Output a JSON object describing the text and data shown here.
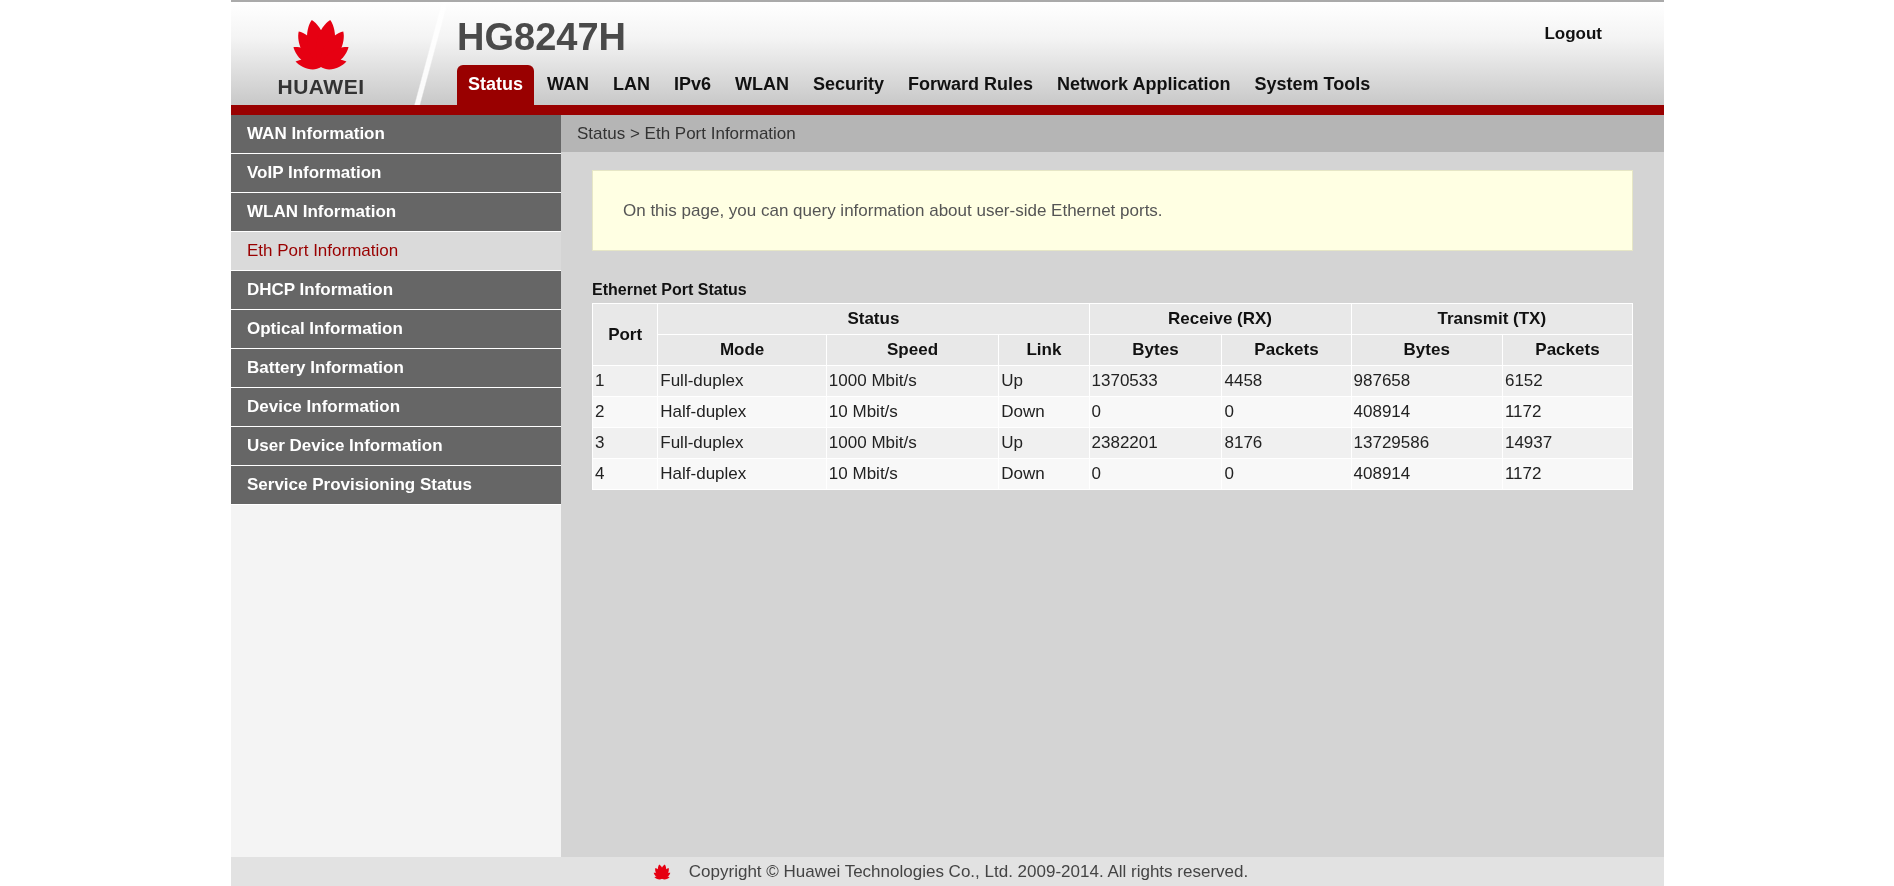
{
  "header": {
    "brand": "HUAWEI",
    "model": "HG8247H",
    "logout": "Logout"
  },
  "tabs": [
    {
      "label": "Status",
      "selected": true
    },
    {
      "label": "WAN",
      "selected": false
    },
    {
      "label": "LAN",
      "selected": false
    },
    {
      "label": "IPv6",
      "selected": false
    },
    {
      "label": "WLAN",
      "selected": false
    },
    {
      "label": "Security",
      "selected": false
    },
    {
      "label": "Forward Rules",
      "selected": false
    },
    {
      "label": "Network Application",
      "selected": false
    },
    {
      "label": "System Tools",
      "selected": false
    }
  ],
  "sidebar": {
    "items": [
      {
        "label": "WAN Information",
        "selected": false
      },
      {
        "label": "VoIP Information",
        "selected": false
      },
      {
        "label": "WLAN Information",
        "selected": false
      },
      {
        "label": "Eth Port Information",
        "selected": true
      },
      {
        "label": "DHCP Information",
        "selected": false
      },
      {
        "label": "Optical Information",
        "selected": false
      },
      {
        "label": "Battery Information",
        "selected": false
      },
      {
        "label": "Device Information",
        "selected": false
      },
      {
        "label": "User Device Information",
        "selected": false
      },
      {
        "label": "Service Provisioning Status",
        "selected": false
      }
    ]
  },
  "breadcrumb": "Status > Eth Port Information",
  "info": "On this page, you can query information about user-side Ethernet ports.",
  "table": {
    "title": "Ethernet Port Status",
    "port_header": "Port",
    "groups": [
      {
        "label": "Status",
        "columns": [
          "Mode",
          "Speed",
          "Link"
        ]
      },
      {
        "label": "Receive (RX)",
        "columns": [
          "Bytes",
          "Packets"
        ]
      },
      {
        "label": "Transmit (TX)",
        "columns": [
          "Bytes",
          "Packets"
        ]
      }
    ],
    "rows": [
      [
        "1",
        "Full-duplex",
        "1000 Mbit/s",
        "Up",
        "1370533",
        "4458",
        "987658",
        "6152"
      ],
      [
        "2",
        "Half-duplex",
        "10 Mbit/s",
        "Down",
        "0",
        "0",
        "408914",
        "1172"
      ],
      [
        "3",
        "Full-duplex",
        "1000 Mbit/s",
        "Up",
        "2382201",
        "8176",
        "13729586",
        "14937"
      ],
      [
        "4",
        "Half-duplex",
        "10 Mbit/s",
        "Down",
        "0",
        "0",
        "408914",
        "1172"
      ]
    ]
  },
  "footer": "Copyright © Huawei Technologies Co., Ltd. 2009-2014. All rights reserved."
}
